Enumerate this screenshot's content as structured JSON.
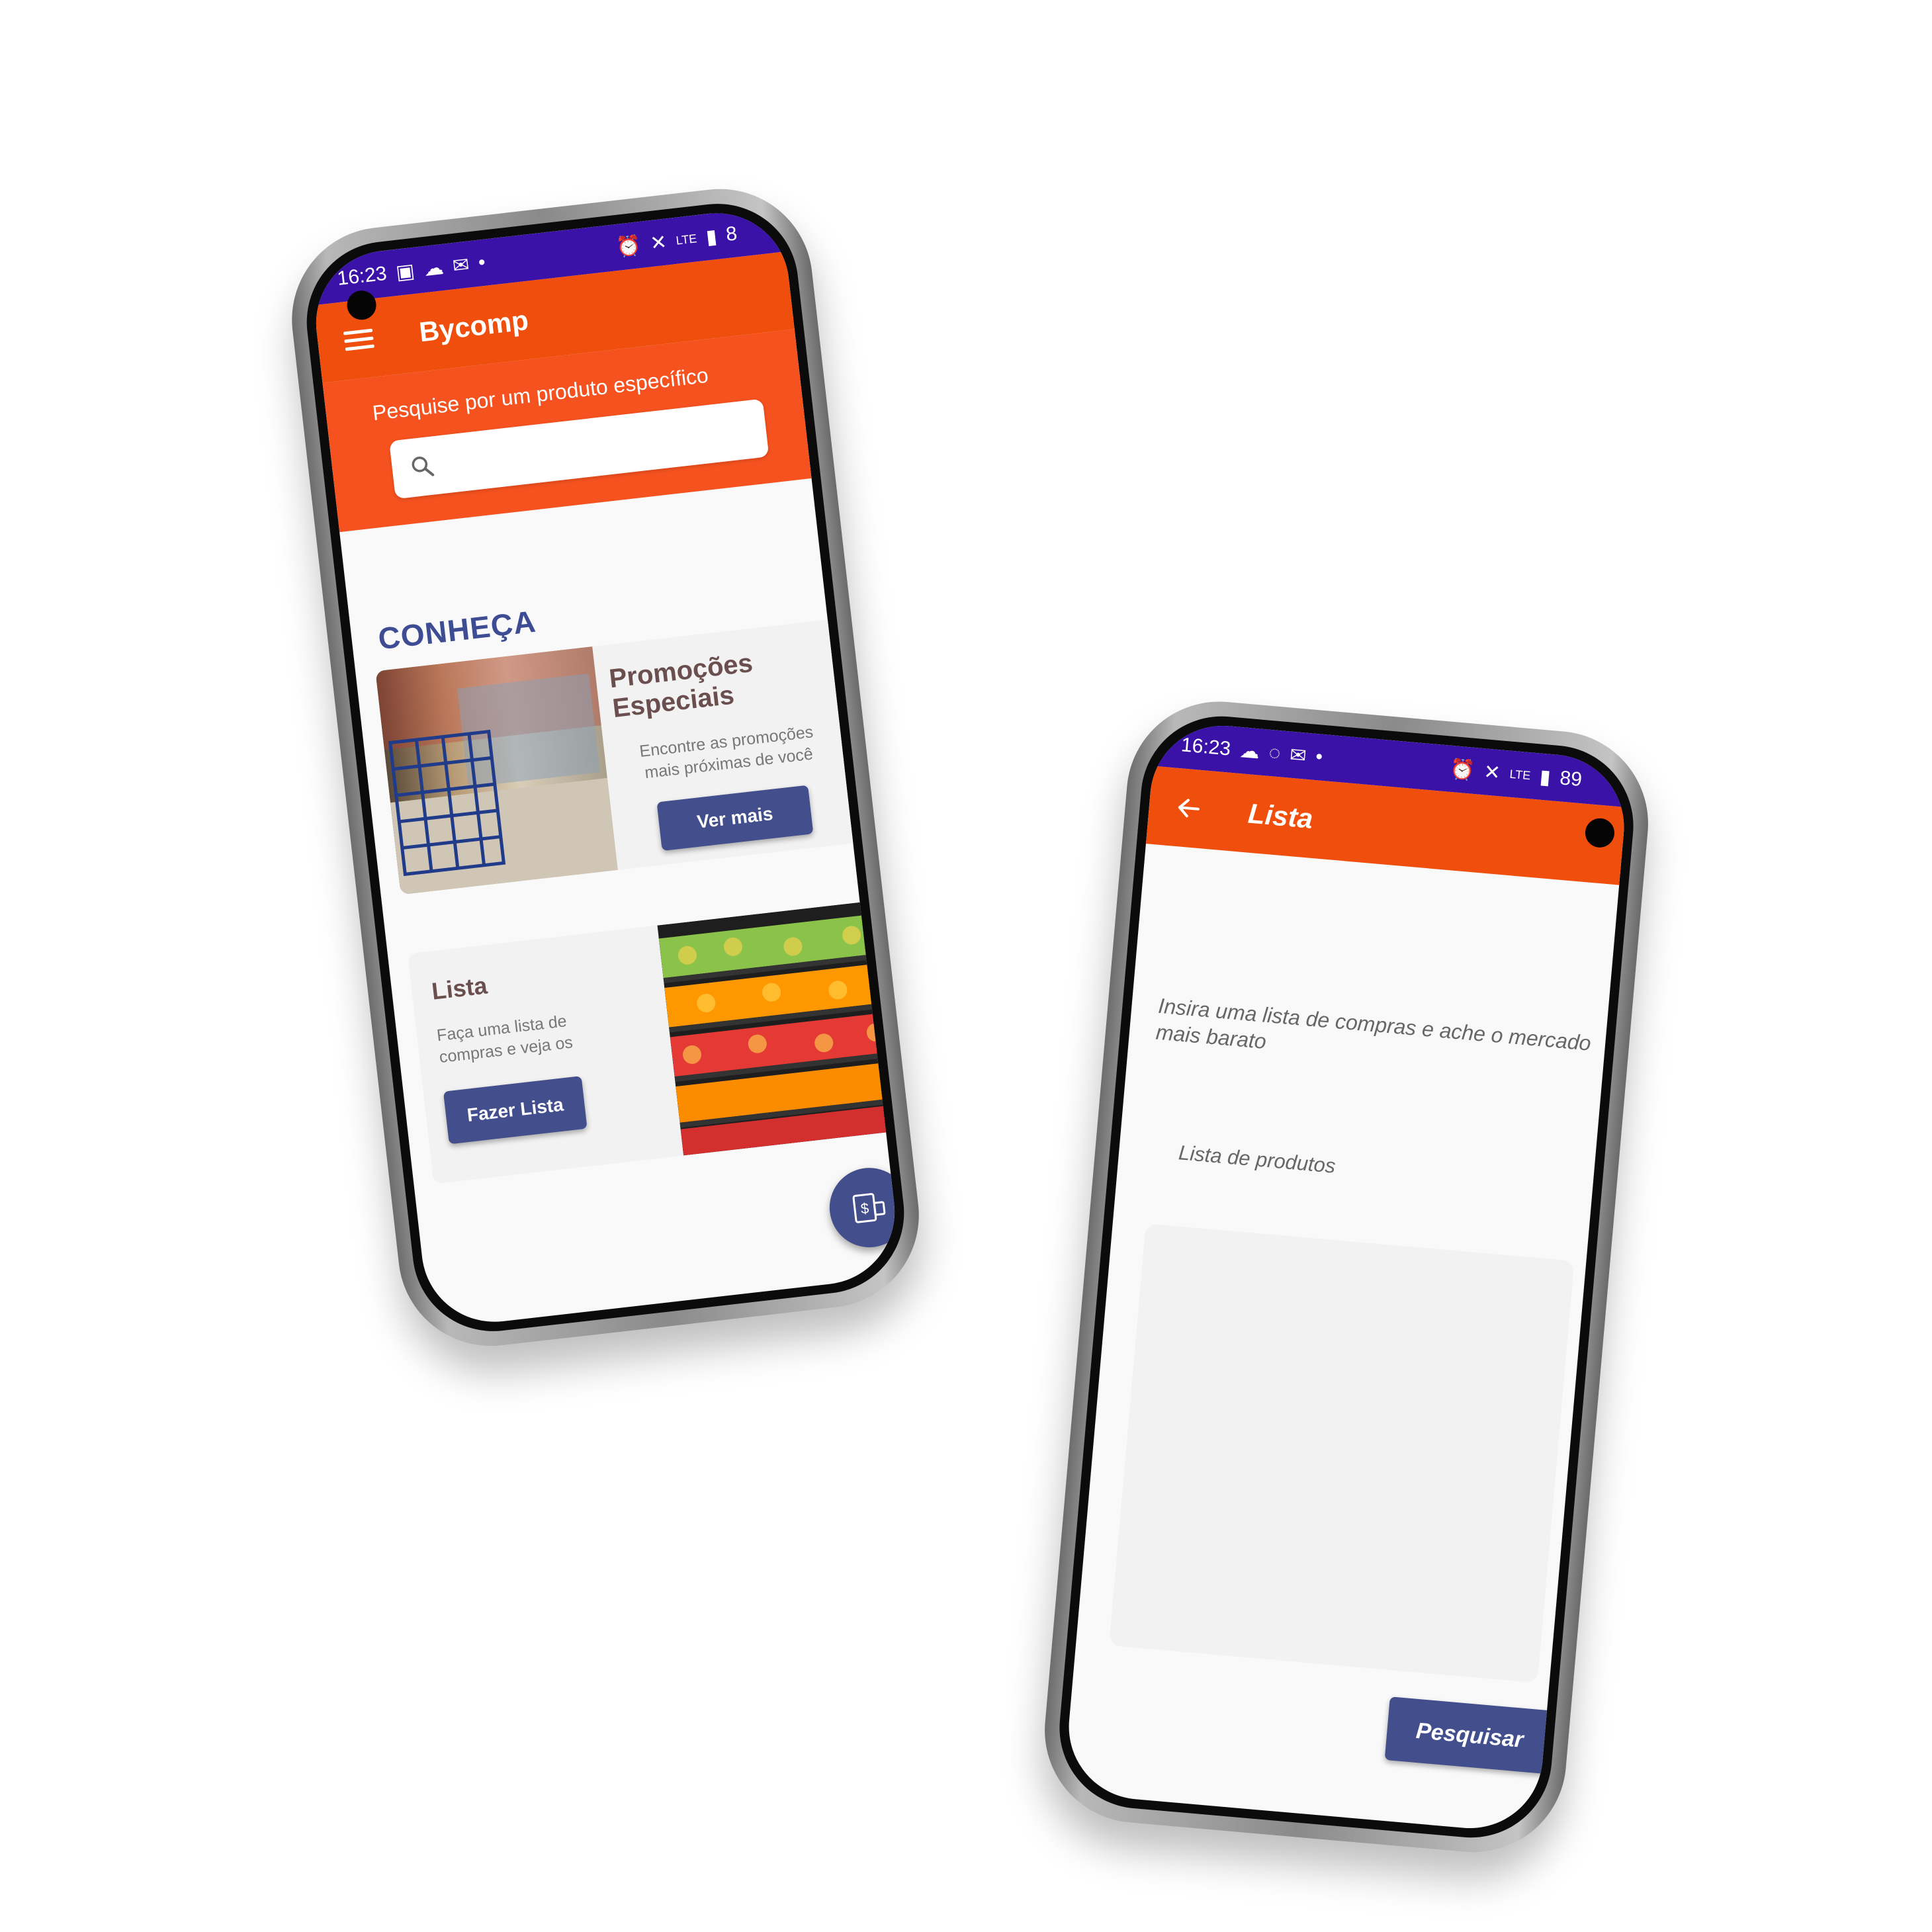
{
  "left_phone": {
    "status": {
      "time": "16:23",
      "battery_partial": "8"
    },
    "appbar": {
      "title": "Bycomp"
    },
    "search": {
      "label": "Pesquise por um produto específico",
      "placeholder": ""
    },
    "section_title": "CONHEÇA",
    "promo_card": {
      "title": "Promoções Especiais",
      "desc_line1": "Encontre as promoções",
      "desc_line2": "mais próximas de você",
      "button": "Ver mais"
    },
    "list_card": {
      "title": "Lista",
      "desc_line1": "Faça uma lista de",
      "desc_line2": "compras  e veja os",
      "button": "Fazer Lista"
    }
  },
  "right_phone": {
    "status": {
      "time": "16:23",
      "battery": "89"
    },
    "appbar": {
      "title": "Lista"
    },
    "hint_line1": "Insira uma lista de compras e ache o mercado",
    "hint_line2": "mais barato",
    "list_label": "Lista de produtos",
    "button": "Pesquisar"
  },
  "colors": {
    "status_bar": "#3b12a8",
    "app_bar": "#ef4e0c",
    "search_area": "#f5521f",
    "accent_button": "#434f8c",
    "section_title": "#3d4c93"
  }
}
